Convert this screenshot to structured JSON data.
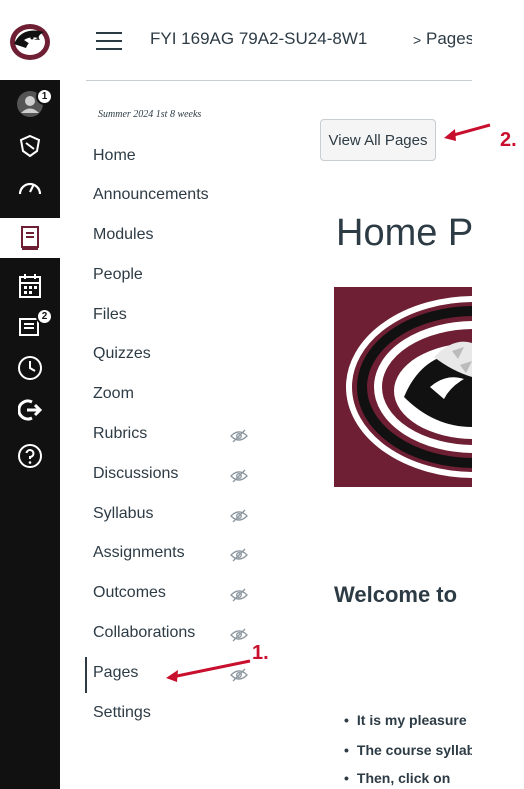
{
  "header": {
    "course_title": "FYI 169AG 79A2-SU24-8W1",
    "breadcrumb_sep": ">",
    "current_page": "Pages"
  },
  "global_nav": {
    "account_badge": "1",
    "inbox_badge": "2"
  },
  "course_nav": {
    "term": "Summer 2024 1st 8 weeks",
    "items": [
      {
        "label": "Home",
        "hidden": false
      },
      {
        "label": "Announcements",
        "hidden": false
      },
      {
        "label": "Modules",
        "hidden": false
      },
      {
        "label": "People",
        "hidden": false
      },
      {
        "label": "Files",
        "hidden": false
      },
      {
        "label": "Quizzes",
        "hidden": false
      },
      {
        "label": "Zoom",
        "hidden": false
      },
      {
        "label": "Rubrics",
        "hidden": true
      },
      {
        "label": "Discussions",
        "hidden": true
      },
      {
        "label": "Syllabus",
        "hidden": true
      },
      {
        "label": "Assignments",
        "hidden": true
      },
      {
        "label": "Outcomes",
        "hidden": true
      },
      {
        "label": "Collaborations",
        "hidden": true
      },
      {
        "label": "Pages",
        "hidden": true,
        "active": true
      },
      {
        "label": "Settings",
        "hidden": false
      }
    ]
  },
  "content": {
    "view_all_label": "View All Pages",
    "page_title": "Home Page",
    "welcome_heading": "Welcome to",
    "bullets": [
      "It is my pleasure",
      "The course syllabus",
      "Then, click on"
    ]
  },
  "annotations": {
    "callout_1": "1.",
    "callout_2": "2."
  },
  "colors": {
    "nav_bg": "#111111",
    "brand_maroon": "#6e1f33",
    "callout_red": "#c8102e",
    "text": "#2d3b45"
  }
}
